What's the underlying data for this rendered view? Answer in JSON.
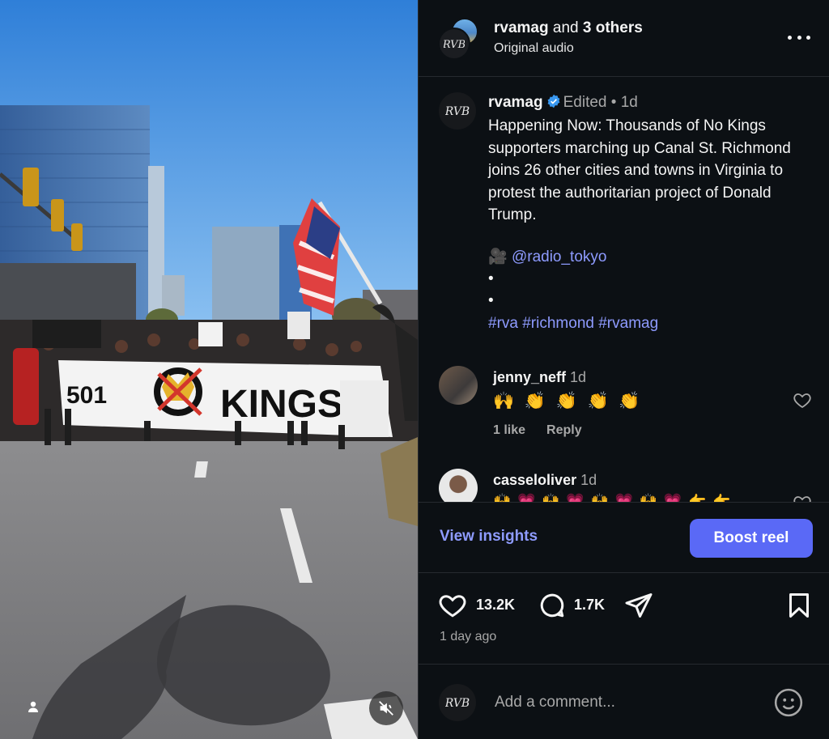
{
  "header": {
    "owner": "rvamag",
    "and_text": " and ",
    "others": "3 others",
    "audio": "Original audio"
  },
  "caption": {
    "username": "rvamag",
    "edited": "Edited",
    "separator": " • ",
    "age": "1d",
    "text": "Happening Now: Thousands of No Kings supporters marching up Canal St. Richmond joins 26 other cities and towns in Virginia to protest the authoritarian project of Donald Trump.",
    "camera_emoji": "🎥",
    "credit": "@radio_tokyo",
    "dot1": "•",
    "dot2": "•",
    "hashtags": "#rva #richmond #rvamag"
  },
  "comments": [
    {
      "username": "jenny_neff",
      "age": "1d",
      "emoji": "🙌 👏 👏 👏 👏",
      "likes": "1 like",
      "reply": "Reply"
    },
    {
      "username": "casseloliver",
      "age": "1d",
      "emoji": "🙌 💗 🙌 💗 🙌 💗 🙌 💗 👉 👉"
    }
  ],
  "insights": {
    "view": "View insights",
    "boost": "Boost reel"
  },
  "engagement": {
    "likes": "13.2K",
    "comments": "1.7K",
    "posted": "1 day ago"
  },
  "composer": {
    "placeholder": "Add a comment..."
  },
  "banner": {
    "left": "501",
    "word": "KINGS"
  },
  "colors": {
    "accent_link": "#8e9bff",
    "boost_button": "#5a69f6",
    "panel_bg": "#0c1014",
    "verified": "#3897f0"
  }
}
